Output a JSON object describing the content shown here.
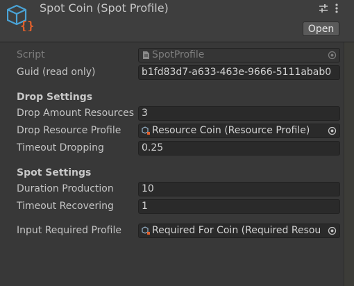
{
  "header": {
    "title": "Spot Coin (Spot Profile)",
    "open_label": "Open",
    "icons": [
      "scriptable-object-icon",
      "sliders-icon",
      "kebab-menu-icon"
    ]
  },
  "fields": {
    "script": {
      "label": "Script",
      "value": "SpotProfile"
    },
    "guid": {
      "label": "Guid (read only)",
      "value": "b1fd83d7-a633-463e-9666-5111abab0"
    }
  },
  "drop_settings": {
    "heading": "Drop Settings",
    "amount": {
      "label": "Drop Amount Resources",
      "value": "3"
    },
    "profile": {
      "label": "Drop Resource Profile",
      "value": "Resource Coin (Resource Profile)"
    },
    "timeout": {
      "label": "Timeout Dropping",
      "value": "0.25"
    }
  },
  "spot_settings": {
    "heading": "Spot Settings",
    "duration": {
      "label": "Duration Production",
      "value": "10"
    },
    "timeout": {
      "label": "Timeout Recovering",
      "value": "1"
    }
  },
  "input": {
    "label": "Input Required Profile",
    "value": "Required For Coin (Required Resou"
  },
  "colors": {
    "background": "#383838",
    "header": "#3e3e3e",
    "field": "#2a2a2a",
    "accent_blue": "#4aa3d6",
    "accent_orange": "#e0602c"
  }
}
